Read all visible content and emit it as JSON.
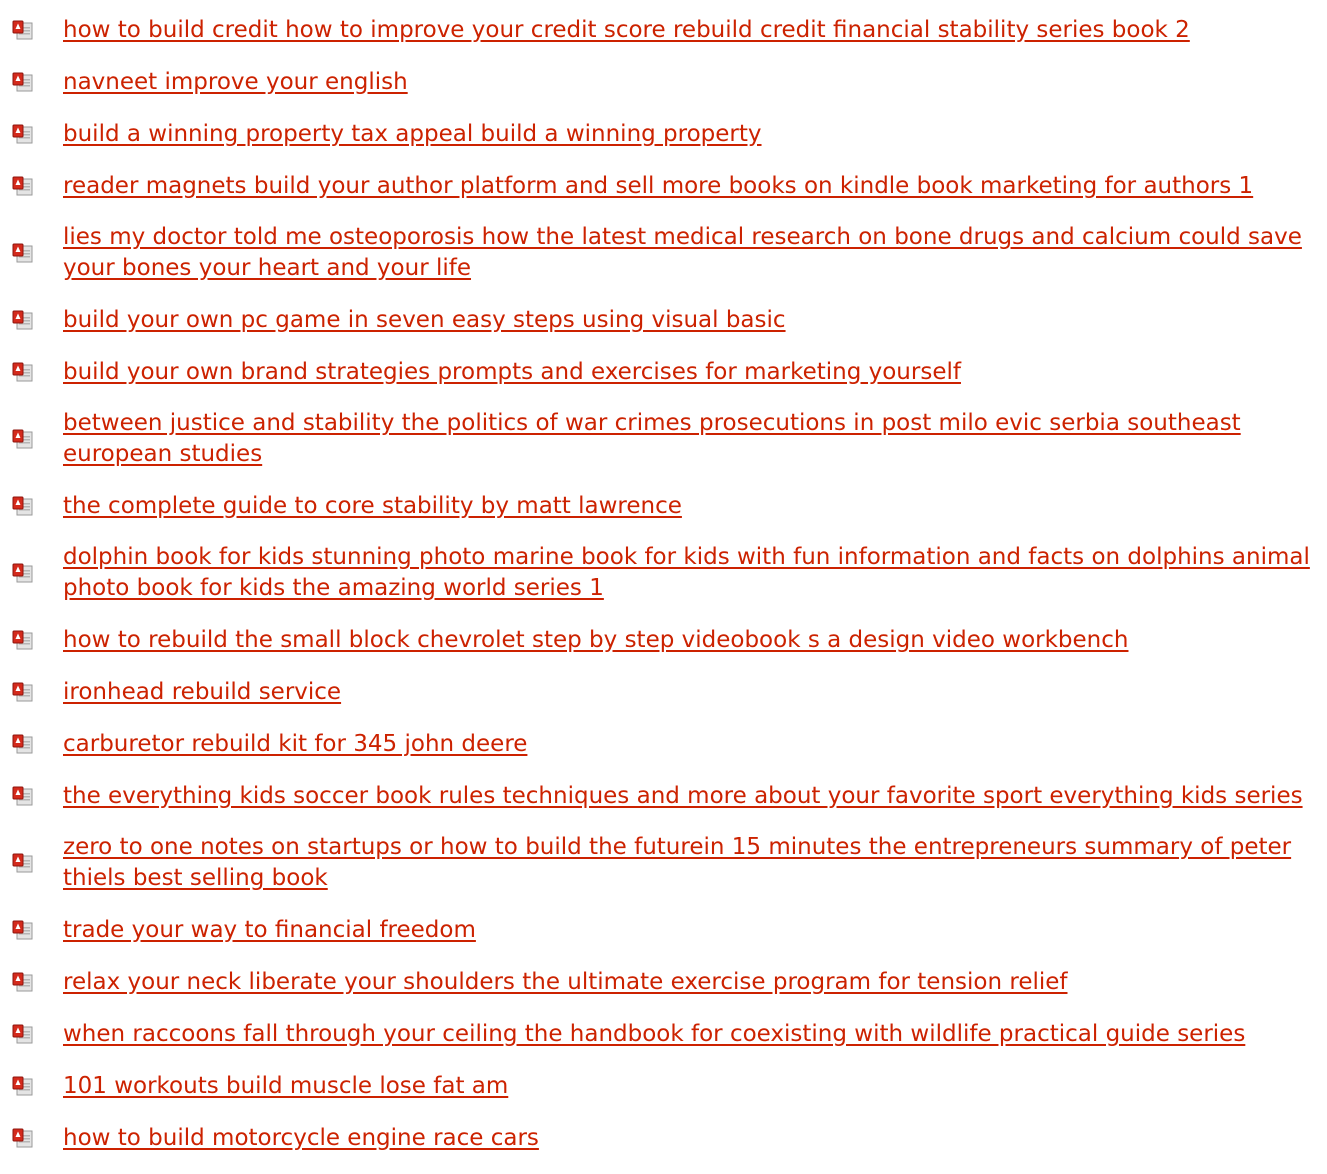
{
  "links": [
    {
      "label": "how to build credit how to improve your credit score rebuild credit financial stability series book 2",
      "lines": 1
    },
    {
      "label": "navneet improve your english",
      "lines": 1
    },
    {
      "label": "build a winning property tax appeal build a winning property",
      "lines": 1
    },
    {
      "label": "reader magnets build your author platform and sell more books on kindle book marketing for authors 1",
      "lines": 1
    },
    {
      "label": "lies my doctor told me osteoporosis how the latest medical research on bone drugs and calcium could save your bones your heart and your life",
      "lines": 2
    },
    {
      "label": "build your own pc game in seven easy steps using visual basic",
      "lines": 1
    },
    {
      "label": "build your own brand strategies prompts and exercises for marketing yourself",
      "lines": 1
    },
    {
      "label": "between justice and stability the politics of war crimes prosecutions in post milo evic serbia southeast european studies",
      "lines": 2
    },
    {
      "label": "the complete guide to core stability by matt lawrence",
      "lines": 1
    },
    {
      "label": "dolphin book for kids stunning photo marine book for kids with fun information and facts on dolphins animal photo book for kids the amazing world series 1",
      "lines": 2
    },
    {
      "label": "how to rebuild the small block chevrolet step by step videobook s a design video workbench",
      "lines": 1
    },
    {
      "label": "ironhead rebuild service",
      "lines": 1
    },
    {
      "label": "carburetor rebuild kit for 345 john deere",
      "lines": 1
    },
    {
      "label": "the everything kids soccer book rules techniques and more about your favorite sport everything kids series",
      "lines": 1
    },
    {
      "label": "zero to one notes on startups or how to build the futurein 15 minutes the entrepreneurs summary of peter thiels best selling book",
      "lines": 2
    },
    {
      "label": "trade your way to financial freedom",
      "lines": 1
    },
    {
      "label": "relax your neck liberate your shoulders the ultimate exercise program for tension relief",
      "lines": 1
    },
    {
      "label": "when raccoons fall through your ceiling the handbook for coexisting with wildlife practical guide series",
      "lines": 1
    },
    {
      "label": "101 workouts build muscle lose fat am",
      "lines": 1
    },
    {
      "label": "how to build motorcycle engine race cars",
      "lines": 1
    }
  ],
  "icon": "pdf-file-icon",
  "colors": {
    "link": "#cc2200",
    "icon_red": "#d42a1c",
    "icon_gray": "#a8a8a8"
  }
}
